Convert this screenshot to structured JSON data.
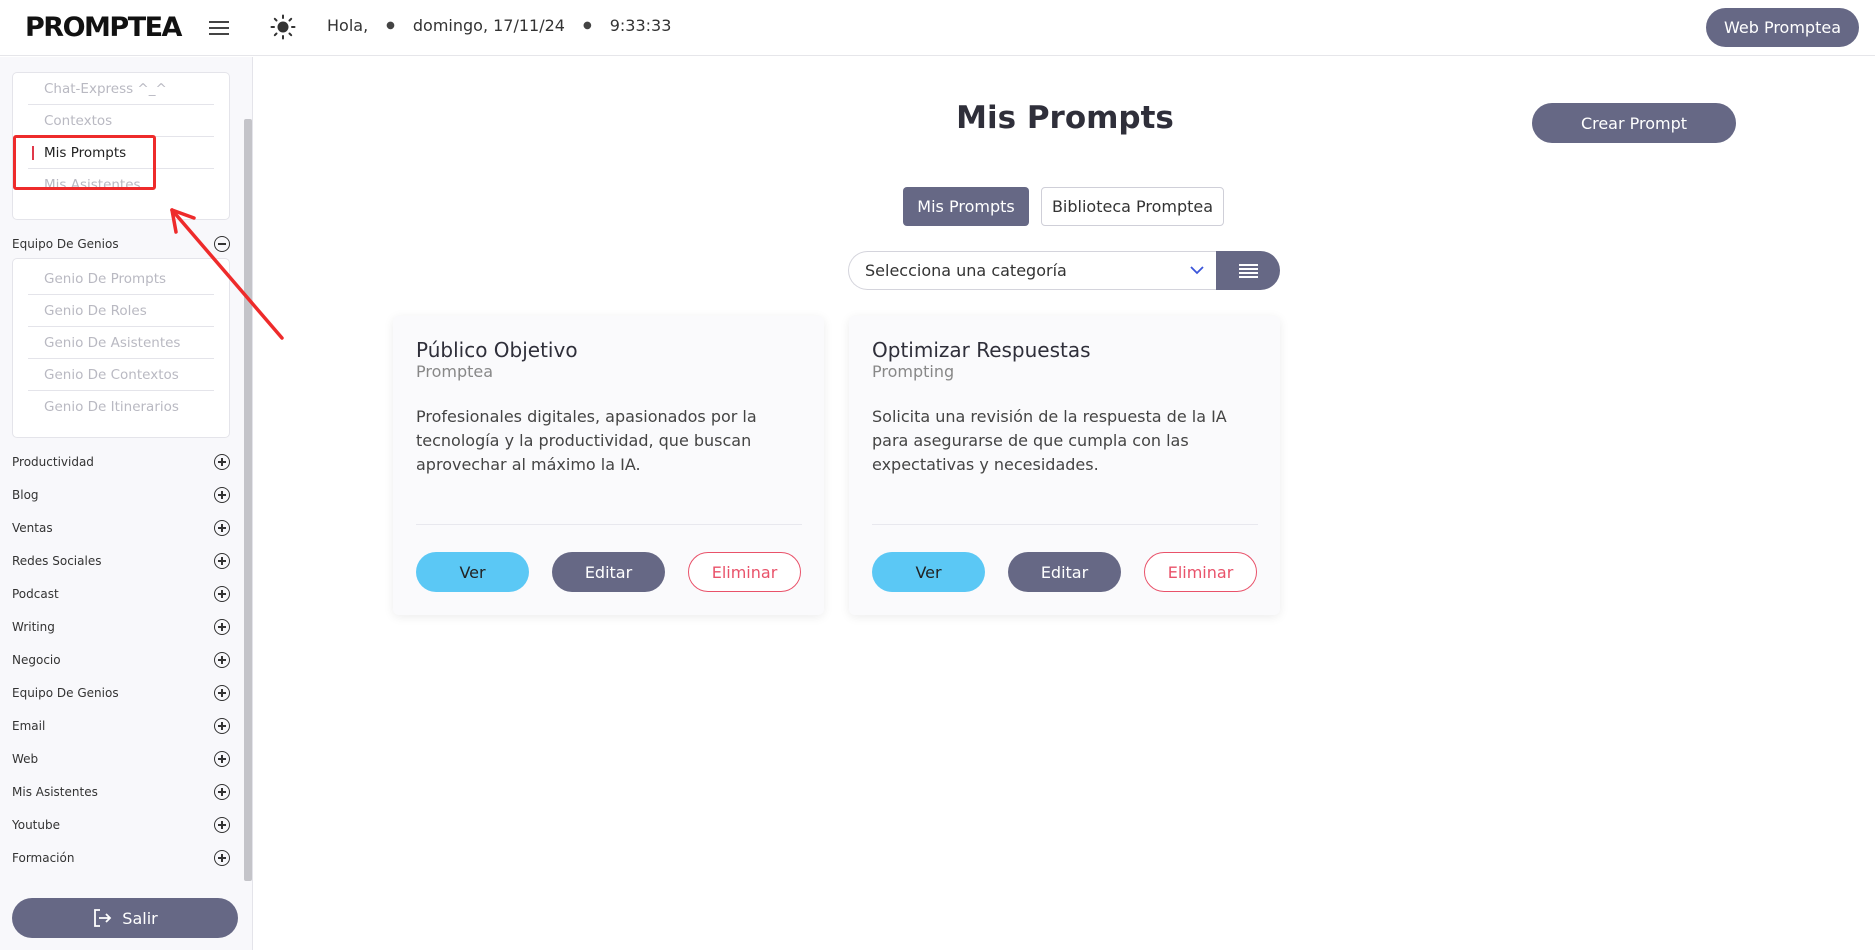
{
  "header": {
    "logo": "PROMPTEA",
    "greeting": "Hola,",
    "date": "domingo, 17/11/24",
    "time": "9:33:33",
    "web_button": "Web Promptea"
  },
  "sidebar": {
    "top_items": [
      "Chat-Express ^_^",
      "Contextos",
      "Mis Prompts",
      "Mis Asistentes"
    ],
    "genios_title": "Equipo De Genios",
    "genios_items": [
      "Genio De Prompts",
      "Genio De Roles",
      "Genio De Asistentes",
      "Genio De Contextos",
      "Genio De Itinerarios"
    ],
    "sections": [
      "Productividad",
      "Blog",
      "Ventas",
      "Redes Sociales",
      "Podcast",
      "Writing",
      "Negocio",
      "Equipo De Genios",
      "Email",
      "Web",
      "Mis Asistentes",
      "Youtube",
      "Formación"
    ],
    "salir": "Salir"
  },
  "main": {
    "title": "Mis Prompts",
    "crear_button": "Crear Prompt",
    "tabs": [
      "Mis Prompts",
      "Biblioteca Promptea"
    ],
    "category_placeholder": "Selecciona una categoría",
    "cards": [
      {
        "title": "Público Objetivo",
        "subtitle": "Promptea",
        "description": "Profesionales digitales, apasionados por la tecnología y la productividad, que buscan aprovechar al máximo la IA.",
        "ver": "Ver",
        "editar": "Editar",
        "eliminar": "Eliminar"
      },
      {
        "title": "Optimizar Respuestas",
        "subtitle": "Prompting",
        "description": "Solicita una revisión de la respuesta de la IA para asegurarse de que cumpla con las expectativas y necesidades.",
        "ver": "Ver",
        "editar": "Editar",
        "eliminar": "Eliminar"
      }
    ]
  },
  "colors": {
    "accent": "#666885",
    "ver": "#5bc8f5",
    "danger": "#e9526a",
    "annotation": "#ee2b2b"
  }
}
